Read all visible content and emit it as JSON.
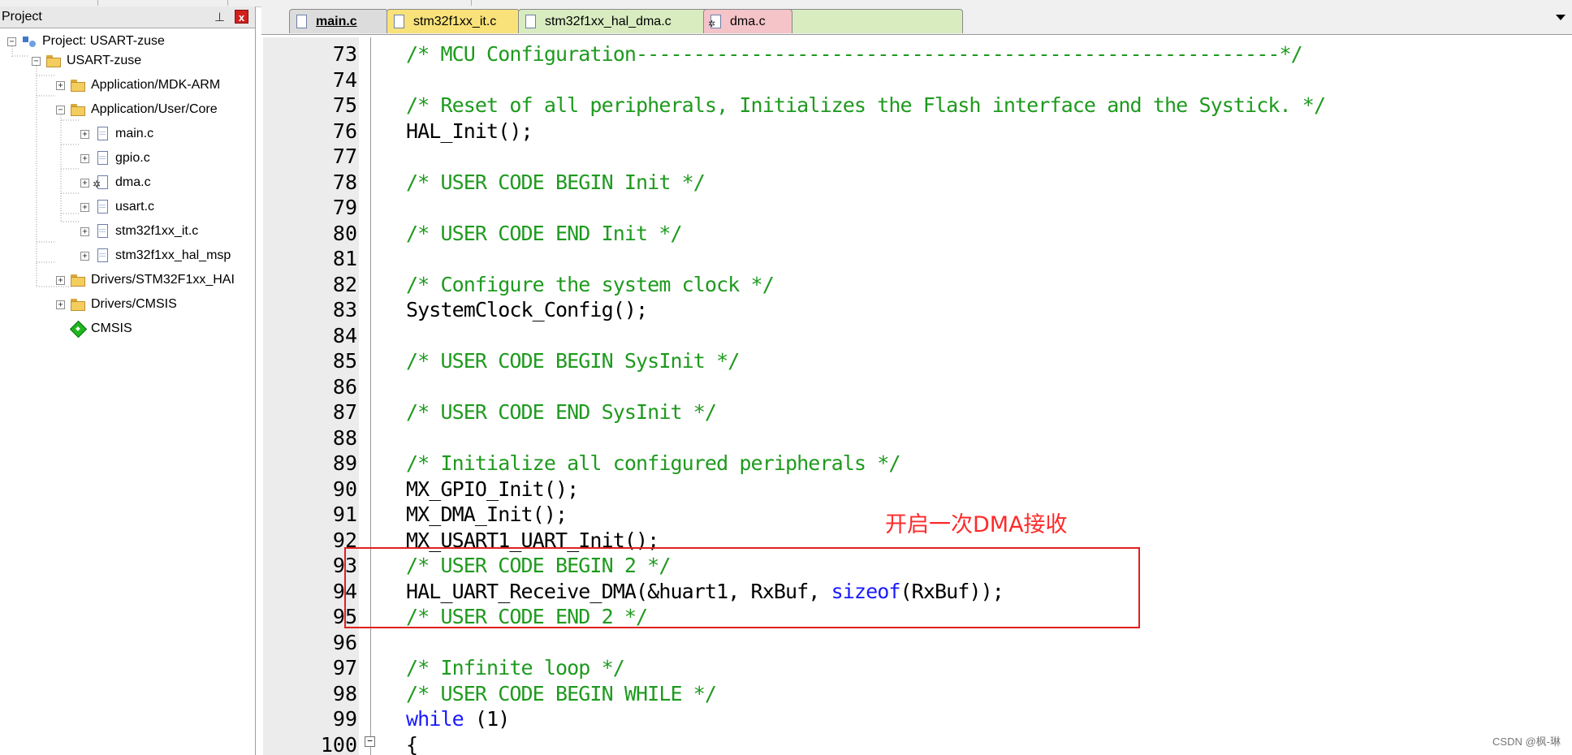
{
  "project_panel": {
    "title": "Project",
    "pin_icon": "pin-icon",
    "close_label": "x",
    "tree": [
      {
        "label": "Project: USART-zuse",
        "icon": "project-icon",
        "toggle": "−"
      },
      {
        "label": "USART-zuse",
        "icon": "target-folder-icon",
        "toggle": "−"
      },
      {
        "label": "Application/MDK-ARM",
        "icon": "folder-icon",
        "toggle": "+"
      },
      {
        "label": "Application/User/Core",
        "icon": "folder-icon",
        "toggle": "−"
      },
      {
        "label": "main.c",
        "icon": "file-icon",
        "toggle": "+"
      },
      {
        "label": "gpio.c",
        "icon": "file-icon",
        "toggle": "+"
      },
      {
        "label": "dma.c",
        "icon": "gear-file-icon",
        "toggle": "+"
      },
      {
        "label": "usart.c",
        "icon": "file-icon",
        "toggle": "+"
      },
      {
        "label": "stm32f1xx_it.c",
        "icon": "file-icon",
        "toggle": "+"
      },
      {
        "label": "stm32f1xx_hal_msp",
        "icon": "file-icon",
        "toggle": "+"
      },
      {
        "label": "Drivers/STM32F1xx_HAI",
        "icon": "folder-icon",
        "toggle": "+"
      },
      {
        "label": "Drivers/CMSIS",
        "icon": "folder-icon",
        "toggle": "+"
      },
      {
        "label": "CMSIS",
        "icon": "diamond-icon",
        "toggle": ""
      }
    ]
  },
  "tabs": [
    {
      "label": "main.c",
      "color": "#dcdcdc",
      "active": true
    },
    {
      "label": "stm32f1xx_it.c",
      "color": "#f9e27a"
    },
    {
      "label": "stm32f1xx_hal_dma.c",
      "color": "#d8ecc0"
    },
    {
      "label": "dma.c",
      "color": "#f4c4c8"
    }
  ],
  "code": {
    "line_numbers": [
      "73",
      "74",
      "75",
      "76",
      "77",
      "78",
      "79",
      "80",
      "81",
      "82",
      "83",
      "84",
      "85",
      "86",
      "87",
      "88",
      "89",
      "90",
      "91",
      "92",
      "93",
      "94",
      "95",
      "96",
      "97",
      "98",
      "99",
      "100"
    ],
    "lines": [
      "/* MCU Configuration--------------------------------------------------------*/",
      "",
      "/* Reset of all peripherals, Initializes the Flash interface and the Systick. */",
      "HAL_Init();",
      "",
      "/* USER CODE BEGIN Init */",
      "",
      "/* USER CODE END Init */",
      "",
      "/* Configure the system clock */",
      "SystemClock_Config();",
      "",
      "/* USER CODE BEGIN SysInit */",
      "",
      "/* USER CODE END SysInit */",
      "",
      "/* Initialize all configured peripherals */",
      "MX_GPIO_Init();",
      "MX_DMA_Init();",
      "MX_USART1_UART_Init();",
      "/* USER CODE BEGIN 2 */",
      "HAL_UART_Receive_DMA(&huart1, RxBuf, sizeof(RxBuf));",
      "/* USER CODE END 2 */",
      "",
      "/* Infinite loop */",
      "/* USER CODE BEGIN WHILE */",
      "while (1)",
      "{"
    ]
  },
  "annotation": "开启一次DMA接收",
  "watermark": "CSDN @枫-琳",
  "colors": {
    "comment": "#1e9a1e",
    "keyword": "#1a1aff",
    "annotation": "#ff2a2a"
  }
}
